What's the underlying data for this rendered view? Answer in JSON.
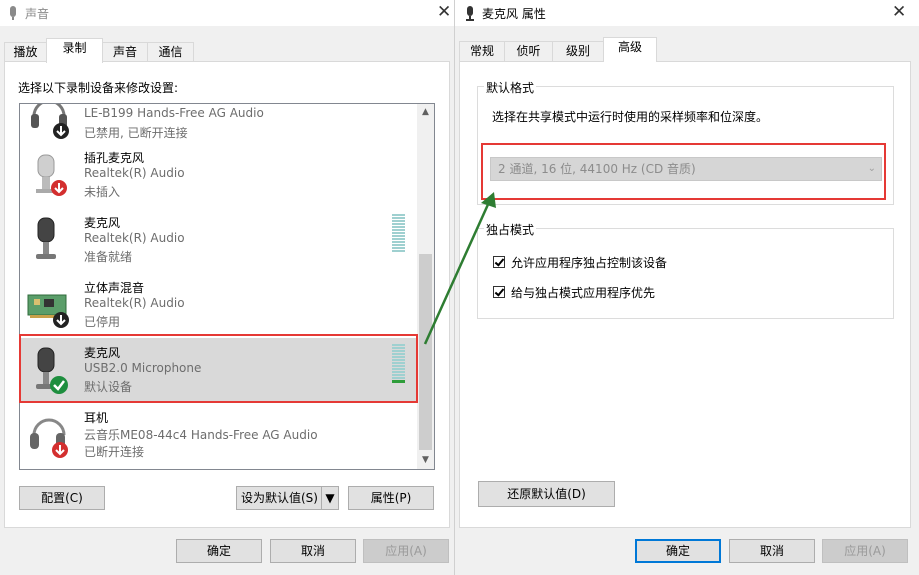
{
  "left_window": {
    "title": "声音",
    "tabs": [
      {
        "label": "播放",
        "active": false
      },
      {
        "label": "录制",
        "active": true
      },
      {
        "label": "声音",
        "active": false
      },
      {
        "label": "通信",
        "active": false
      }
    ],
    "instruction": "选择以下录制设备来修改设置:",
    "devices": [
      {
        "name": "",
        "desc": "LE-B199 Hands-Free AG Audio",
        "status": "已禁用, 已断开连接",
        "badge": "down-arrow"
      },
      {
        "name": "插孔麦克风",
        "desc": "Realtek(R) Audio",
        "status": "未插入",
        "badge": "red-down-arrow"
      },
      {
        "name": "麦克风",
        "desc": "Realtek(R) Audio",
        "status": "准备就绪",
        "badge": "none"
      },
      {
        "name": "立体声混音",
        "desc": "Realtek(R) Audio",
        "status": "已停用",
        "badge": "down-arrow"
      },
      {
        "name": "麦克风",
        "desc": "USB2.0 Microphone",
        "status": "默认设备",
        "badge": "green-check",
        "selected": true
      },
      {
        "name": "耳机",
        "desc": "云音乐ME08-44c4 Hands-Free AG Audio",
        "status": "已断开连接",
        "badge": "red-down-arrow"
      }
    ],
    "buttons": {
      "configure": "配置(C)",
      "set_default": "设为默认值(S)",
      "properties": "属性(P)",
      "ok": "确定",
      "cancel": "取消",
      "apply": "应用(A)"
    }
  },
  "right_window": {
    "title": "麦克风 属性",
    "tabs": [
      {
        "label": "常规",
        "active": false
      },
      {
        "label": "侦听",
        "active": false
      },
      {
        "label": "级别",
        "active": false
      },
      {
        "label": "高级",
        "active": true
      }
    ],
    "default_format": {
      "group_label": "默认格式",
      "description": "选择在共享模式中运行时使用的采样频率和位深度。",
      "selected_format": "2 通道, 16 位, 44100 Hz (CD 音质)"
    },
    "exclusive_mode": {
      "group_label": "独占模式",
      "options": [
        {
          "label": "允许应用程序独占控制该设备",
          "checked": true
        },
        {
          "label": "给与独占模式应用程序优先",
          "checked": true
        }
      ]
    },
    "buttons": {
      "restore_defaults": "还原默认值(D)",
      "ok": "确定",
      "cancel": "取消",
      "apply": "应用(A)"
    }
  },
  "colors": {
    "highlight_box": "#e53935",
    "arrow": "#2e7d32",
    "meter": "#9fd0d0",
    "meter_active": "#2e9d3a"
  },
  "meters": {
    "ready_microphone_level": 0.0,
    "usb_microphone_level": 0.08
  }
}
